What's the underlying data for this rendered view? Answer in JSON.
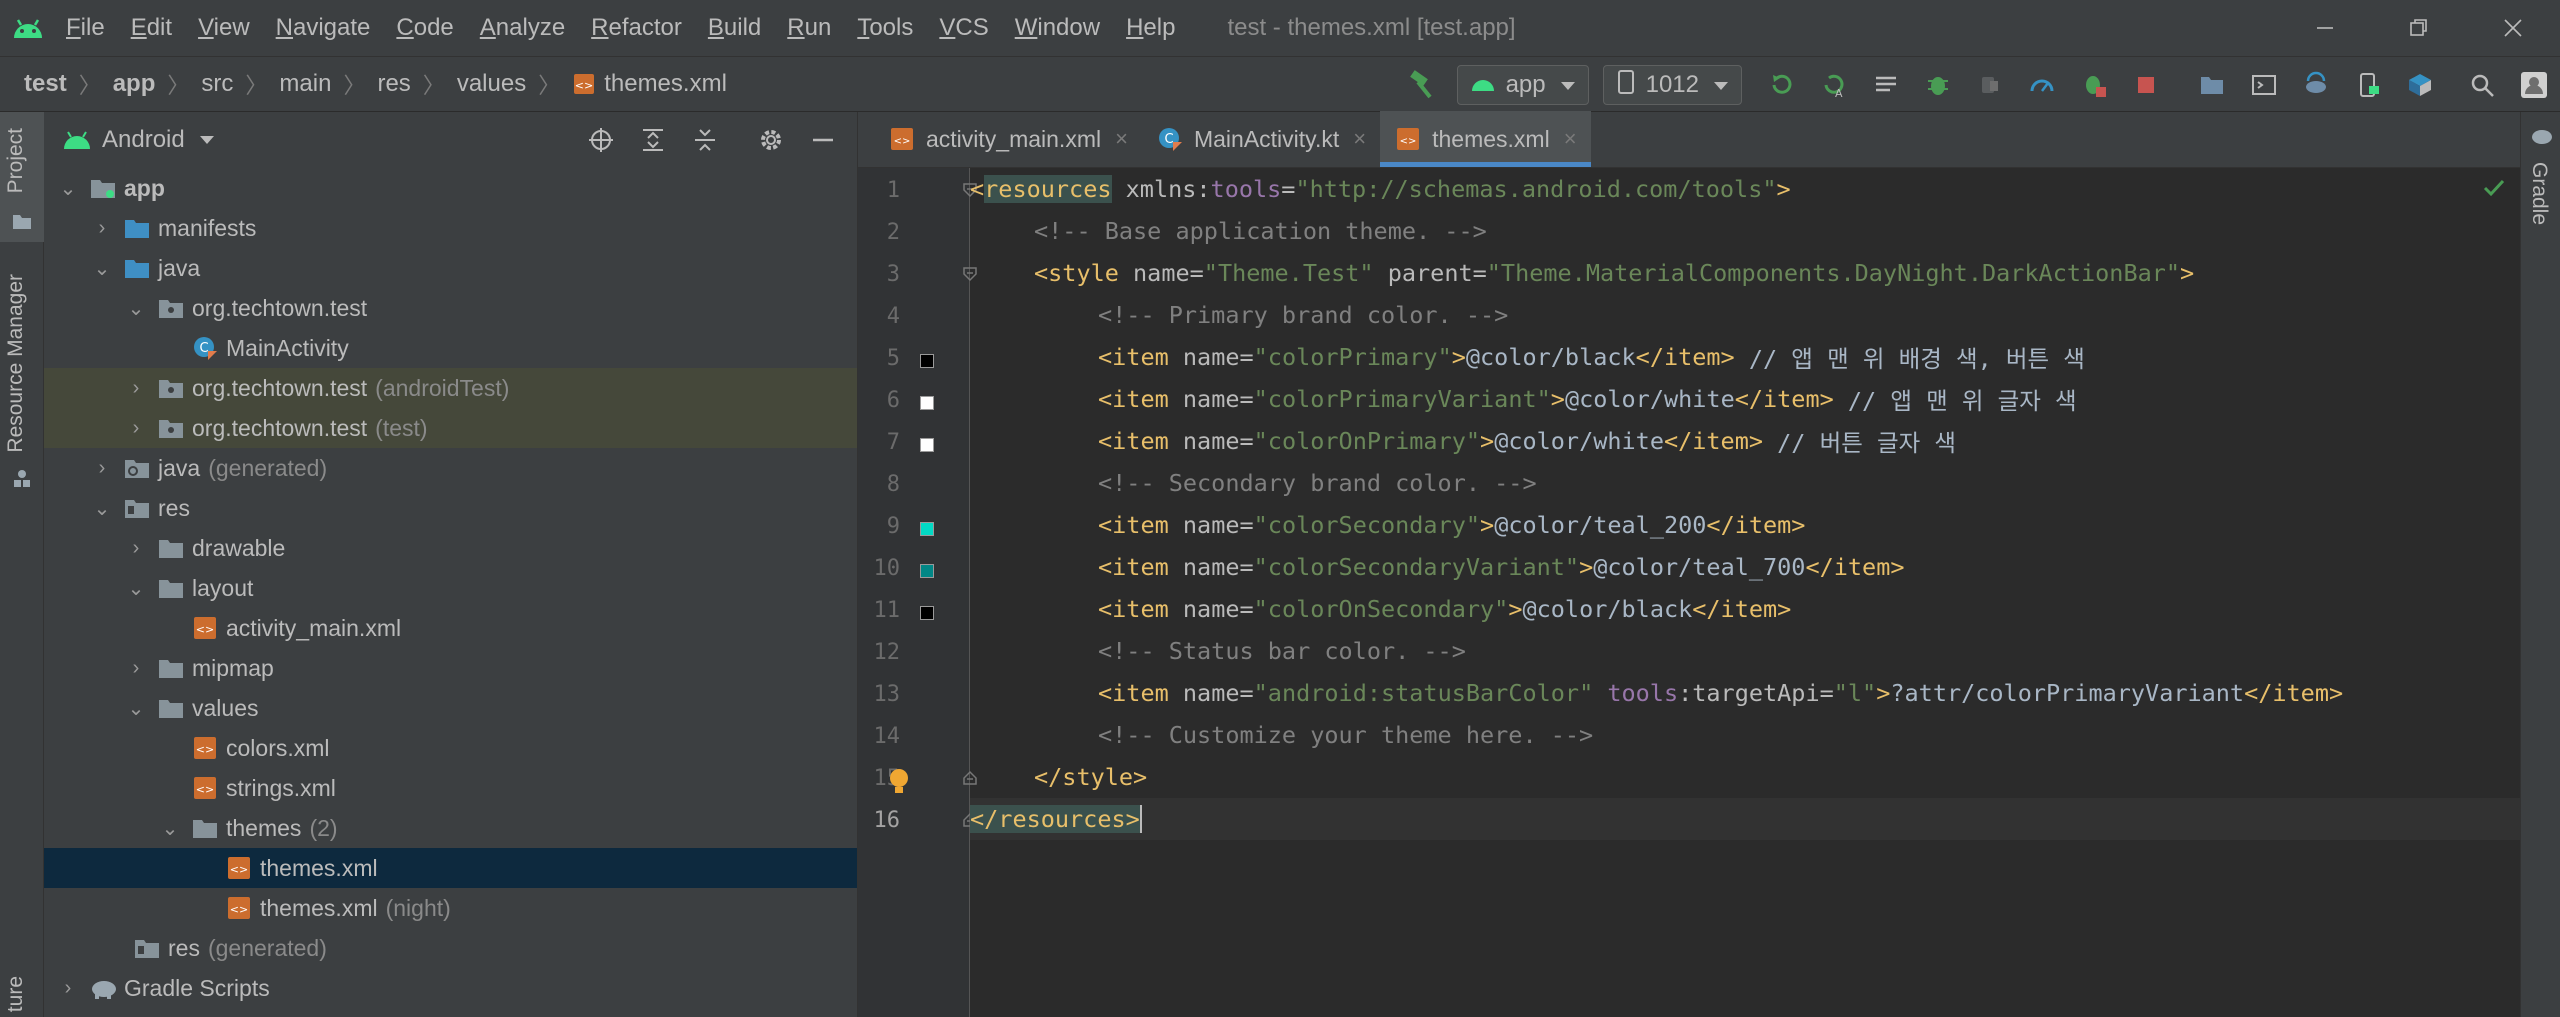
{
  "menu": {
    "items": [
      {
        "mnemonic": "F",
        "rest": "ile"
      },
      {
        "mnemonic": "E",
        "rest": "dit"
      },
      {
        "mnemonic": "V",
        "rest": "iew"
      },
      {
        "mnemonic": "N",
        "rest": "avigate"
      },
      {
        "mnemonic": "C",
        "rest": "ode"
      },
      {
        "mnemonic": "A",
        "rest": "nalyze"
      },
      {
        "mnemonic": "R",
        "rest": "efactor"
      },
      {
        "mnemonic": "B",
        "rest": "uild"
      },
      {
        "mnemonic": "R",
        "rest": "un"
      },
      {
        "mnemonic": "T",
        "rest": "ools"
      },
      {
        "mnemonic": "V",
        "rest": "CS"
      },
      {
        "mnemonic": "W",
        "rest": "indow"
      },
      {
        "mnemonic": "H",
        "rest": "elp"
      }
    ],
    "window_title": "test - themes.xml [test.app]"
  },
  "breadcrumb": {
    "items": [
      "test",
      "app",
      "src",
      "main",
      "res",
      "values",
      "themes.xml"
    ]
  },
  "toolbar": {
    "run_config": "app",
    "device": "1012"
  },
  "side_tabs": {
    "project": "Project",
    "resource_manager": "Resource Manager",
    "structure": "ture",
    "gradle": "Gradle"
  },
  "project_panel": {
    "view": "Android",
    "tree": [
      {
        "label": "app",
        "bold": true
      },
      {
        "label": "manifests"
      },
      {
        "label": "java"
      },
      {
        "label": "org.techtown.test"
      },
      {
        "label": "MainActivity"
      },
      {
        "label": "org.techtown.test",
        "suffix": "(androidTest)"
      },
      {
        "label": "org.techtown.test",
        "suffix": "(test)"
      },
      {
        "label": "java",
        "suffix": "(generated)"
      },
      {
        "label": "res"
      },
      {
        "label": "drawable"
      },
      {
        "label": "layout"
      },
      {
        "label": "activity_main.xml"
      },
      {
        "label": "mipmap"
      },
      {
        "label": "values"
      },
      {
        "label": "colors.xml"
      },
      {
        "label": "strings.xml"
      },
      {
        "label": "themes",
        "suffix": "(2)"
      },
      {
        "label": "themes.xml"
      },
      {
        "label": "themes.xml",
        "suffix": "(night)"
      },
      {
        "label": "res",
        "suffix": "(generated)"
      },
      {
        "label": "Gradle Scripts"
      }
    ]
  },
  "editor": {
    "tabs": [
      {
        "label": "activity_main.xml"
      },
      {
        "label": "MainActivity.kt"
      },
      {
        "label": "themes.xml",
        "active": true
      }
    ],
    "line_numbers": [
      "1",
      "2",
      "3",
      "4",
      "5",
      "6",
      "7",
      "8",
      "9",
      "10",
      "11",
      "12",
      "13",
      "14",
      "15",
      "16"
    ],
    "swatch_colors": {
      "line5": "#000000",
      "line6": "#ffffff",
      "line7": "#ffffff",
      "line9": "#03dac5",
      "line10": "#018786",
      "line11": "#000000"
    },
    "code": {
      "l1": {
        "open": "<",
        "tag": "resources",
        "ns_attr": " xmlns:",
        "ns_name": "tools",
        "eq": "=",
        "value": "\"http://schemas.android.com/tools\"",
        "close": ">"
      },
      "l2": "<!-- Base application theme. -->",
      "l3": {
        "open": "<style",
        "a1": " name",
        "eq1": "=",
        "v1": "\"Theme.Test\"",
        "a2": " parent",
        "eq2": "=",
        "v2": "\"Theme.MaterialComponents.DayNight.DarkActionBar\"",
        "close": ">"
      },
      "l4": "<!-- Primary brand color. -->",
      "l5": {
        "open": "<item",
        "attr": " name",
        "eq": "=",
        "value": "\"colorPrimary\"",
        "gt": ">",
        "text": "@color/black",
        "end": "</item>",
        "comment": " // 앱 맨 위 배경 색, 버튼 색"
      },
      "l6": {
        "open": "<item",
        "attr": " name",
        "eq": "=",
        "value": "\"colorPrimaryVariant\"",
        "gt": ">",
        "text": "@color/white",
        "end": "</item>",
        "comment": " // 앱 맨 위 글자 색"
      },
      "l7": {
        "open": "<item",
        "attr": " name",
        "eq": "=",
        "value": "\"colorOnPrimary\"",
        "gt": ">",
        "text": "@color/white",
        "end": "</item>",
        "comment": " // 버튼 글자 색"
      },
      "l8": "<!-- Secondary brand color. -->",
      "l9": {
        "open": "<item",
        "attr": " name",
        "eq": "=",
        "value": "\"colorSecondary\"",
        "gt": ">",
        "text": "@color/teal_200",
        "end": "</item>"
      },
      "l10": {
        "open": "<item",
        "attr": " name",
        "eq": "=",
        "value": "\"colorSecondaryVariant\"",
        "gt": ">",
        "text": "@color/teal_700",
        "end": "</item>"
      },
      "l11": {
        "open": "<item",
        "attr": " name",
        "eq": "=",
        "value": "\"colorOnSecondary\"",
        "gt": ">",
        "text": "@color/black",
        "end": "</item>"
      },
      "l12": "<!-- Status bar color. -->",
      "l13": {
        "open": "<item",
        "attr": " name",
        "eq": "=",
        "value": "\"android:statusBarColor\"",
        "ns_attr": " tools",
        "colon": ":",
        "attr2": "targetApi",
        "eq2": "=",
        "value2": "\"l\"",
        "gt": ">",
        "text": "?attr/colorPrimaryVariant",
        "end": "</item>"
      },
      "l14": "<!-- Customize your theme here. -->",
      "l15": "</style>",
      "l16": "</resources>"
    }
  },
  "colors": {
    "accent": "#4a88c7",
    "selection": "#0d293e",
    "android_green": "#3ddc84"
  }
}
